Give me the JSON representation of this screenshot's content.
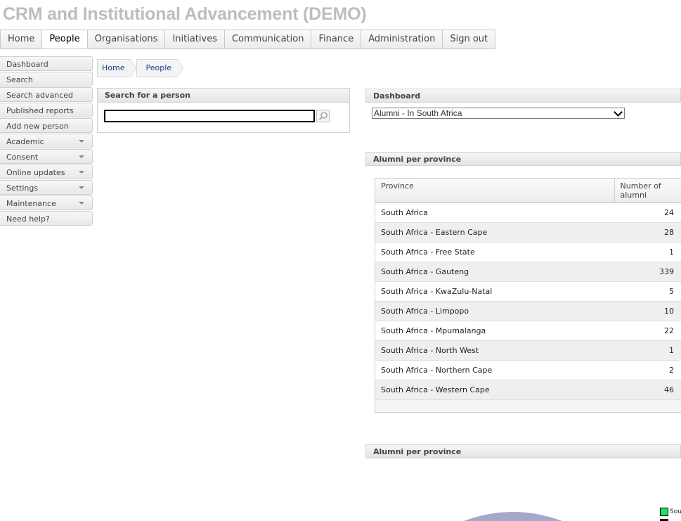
{
  "app": {
    "title": "CRM and Institutional Advancement (DEMO)"
  },
  "topnav": [
    "Home",
    "People",
    "Organisations",
    "Initiatives",
    "Communication",
    "Finance",
    "Administration",
    "Sign out"
  ],
  "topnav_active": "People",
  "sidenav": [
    {
      "label": "Dashboard",
      "has_submenu": false
    },
    {
      "label": "Search",
      "has_submenu": false
    },
    {
      "label": "Search advanced",
      "has_submenu": false
    },
    {
      "label": "Published reports",
      "has_submenu": false
    },
    {
      "label": "Add new person",
      "has_submenu": false
    },
    {
      "label": "Academic",
      "has_submenu": true
    },
    {
      "label": "Consent",
      "has_submenu": true
    },
    {
      "label": "Online updates",
      "has_submenu": true
    },
    {
      "label": "Settings",
      "has_submenu": true
    },
    {
      "label": "Maintenance",
      "has_submenu": true
    },
    {
      "label": "Need help?",
      "has_submenu": false
    }
  ],
  "breadcrumb": [
    "Home",
    "People"
  ],
  "search_panel": {
    "title": "Search for a person",
    "value": ""
  },
  "dashboard": {
    "title": "Dashboard",
    "selected": "Alumni - In South Africa"
  },
  "alumni_table": {
    "title": "Alumni per province",
    "columns": [
      "Province",
      "Number of alumni"
    ],
    "rows": [
      {
        "province": "South Africa",
        "count": "24"
      },
      {
        "province": "South Africa - Eastern Cape",
        "count": "28"
      },
      {
        "province": "South Africa - Free State",
        "count": "1"
      },
      {
        "province": "South Africa - Gauteng",
        "count": "339"
      },
      {
        "province": "South Africa - KwaZulu-Natal",
        "count": "5"
      },
      {
        "province": "South Africa - Limpopo",
        "count": "10"
      },
      {
        "province": "South Africa - Mpumalanga",
        "count": "22"
      },
      {
        "province": "South Africa - North West",
        "count": "1"
      },
      {
        "province": "South Africa - Northern Cape",
        "count": "2"
      },
      {
        "province": "South Africa - Western Cape",
        "count": "46"
      }
    ]
  },
  "alumni_chart": {
    "title": "Alumni per province",
    "legend_first": "Sou",
    "colors": {
      "slice": "#a7a7cc",
      "legend": "#22dd66"
    }
  }
}
